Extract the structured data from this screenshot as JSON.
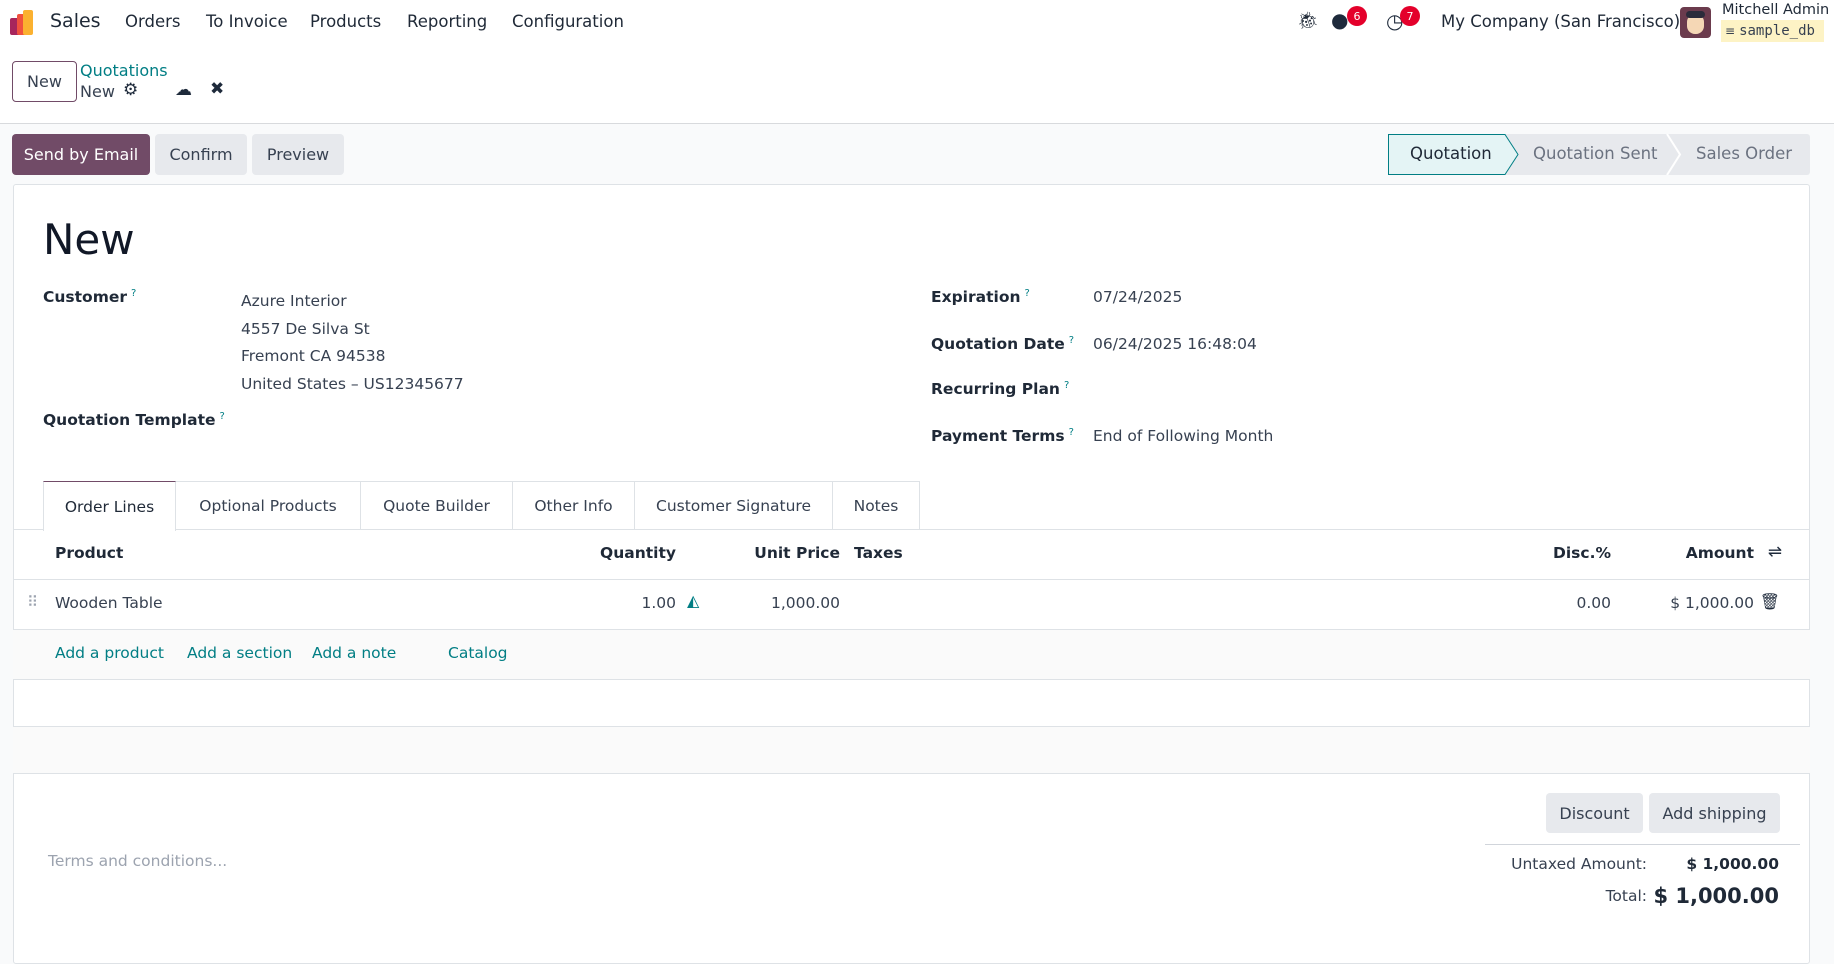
{
  "navbar": {
    "app": "Sales",
    "menu": [
      "Orders",
      "To Invoice",
      "Products",
      "Reporting",
      "Configuration"
    ],
    "messages_count": "6",
    "activities_count": "7",
    "company": "My Company (San Francisco)",
    "user": "Mitchell Admin",
    "database": "sample_db"
  },
  "control": {
    "new_label": "New",
    "breadcrumb_parent": "Quotations",
    "breadcrumb_current": "New"
  },
  "actions": {
    "send_email": "Send by Email",
    "confirm": "Confirm",
    "preview": "Preview"
  },
  "status": {
    "steps": [
      "Quotation",
      "Quotation Sent",
      "Sales Order"
    ],
    "active": "Quotation"
  },
  "form": {
    "title": "New",
    "customer_label": "Customer",
    "customer_lines": [
      "Azure Interior",
      "4557 De Silva St",
      "Fremont CA 94538",
      "United States – US12345677"
    ],
    "template_label": "Quotation Template",
    "expiration_label": "Expiration",
    "expiration": "07/24/2025",
    "quotation_date_label": "Quotation Date",
    "quotation_date": "06/24/2025 16:48:04",
    "recurring_label": "Recurring Plan",
    "payment_terms_label": "Payment Terms",
    "payment_terms": "End of Following Month",
    "help": "?"
  },
  "tabs": [
    "Order Lines",
    "Optional Products",
    "Quote Builder",
    "Other Info",
    "Customer Signature",
    "Notes"
  ],
  "table": {
    "headers": {
      "product": "Product",
      "quantity": "Quantity",
      "unit_price": "Unit Price",
      "taxes": "Taxes",
      "discount": "Disc.%",
      "amount": "Amount"
    },
    "rows": [
      {
        "product": "Wooden Table",
        "quantity": "1.00",
        "unit_price": "1,000.00",
        "taxes": "",
        "discount": "0.00",
        "amount": "$ 1,000.00"
      }
    ],
    "add_links": [
      "Add a product",
      "Add a section",
      "Add a note",
      "Catalog"
    ]
  },
  "footer": {
    "terms_placeholder": "Terms and conditions...",
    "discount": "Discount",
    "add_shipping": "Add shipping",
    "untaxed_label": "Untaxed Amount:",
    "untaxed": "$ 1,000.00",
    "total_label": "Total:",
    "total": "$ 1,000.00"
  },
  "colors": {
    "primary": "#714b67",
    "accent": "#017e84",
    "badge": "#e4002b"
  }
}
